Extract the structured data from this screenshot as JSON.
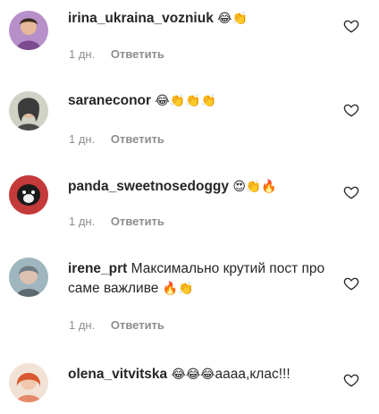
{
  "comments": [
    {
      "username": "irina_ukraina_vozniuk",
      "text": "",
      "emoji": "😂👏",
      "time": "1 дн.",
      "reply": "Ответить",
      "avatar_colors": [
        "#7b4a8f",
        "#e7b89a"
      ]
    },
    {
      "username": "saraneconor",
      "text": "",
      "emoji": "😂👏👏👏",
      "time": "1 дн.",
      "reply": "Ответить",
      "avatar_colors": [
        "#3b3b3b",
        "#e0b9a0"
      ]
    },
    {
      "username": "panda_sweetnosedoggy",
      "text": "",
      "emoji": "😍👏🔥",
      "time": "1 дн.",
      "reply": "Ответить",
      "avatar_colors": [
        "#1a1a1a",
        "#c43a3a"
      ]
    },
    {
      "username": "irene_prt",
      "text": "Максимально крутий пост про саме важливе",
      "emoji": "🔥👏",
      "time": "1 дн.",
      "reply": "Ответить",
      "avatar_colors": [
        "#6e7c84",
        "#ddc2b2"
      ]
    },
    {
      "username": "olena_vitvitska",
      "text": "аааа,клас!!!",
      "emoji": "😂😂😂",
      "time": "",
      "reply": "",
      "avatar_colors": [
        "#d9582f",
        "#f1c8ae"
      ]
    }
  ],
  "icons": {
    "like": "heart-icon"
  }
}
